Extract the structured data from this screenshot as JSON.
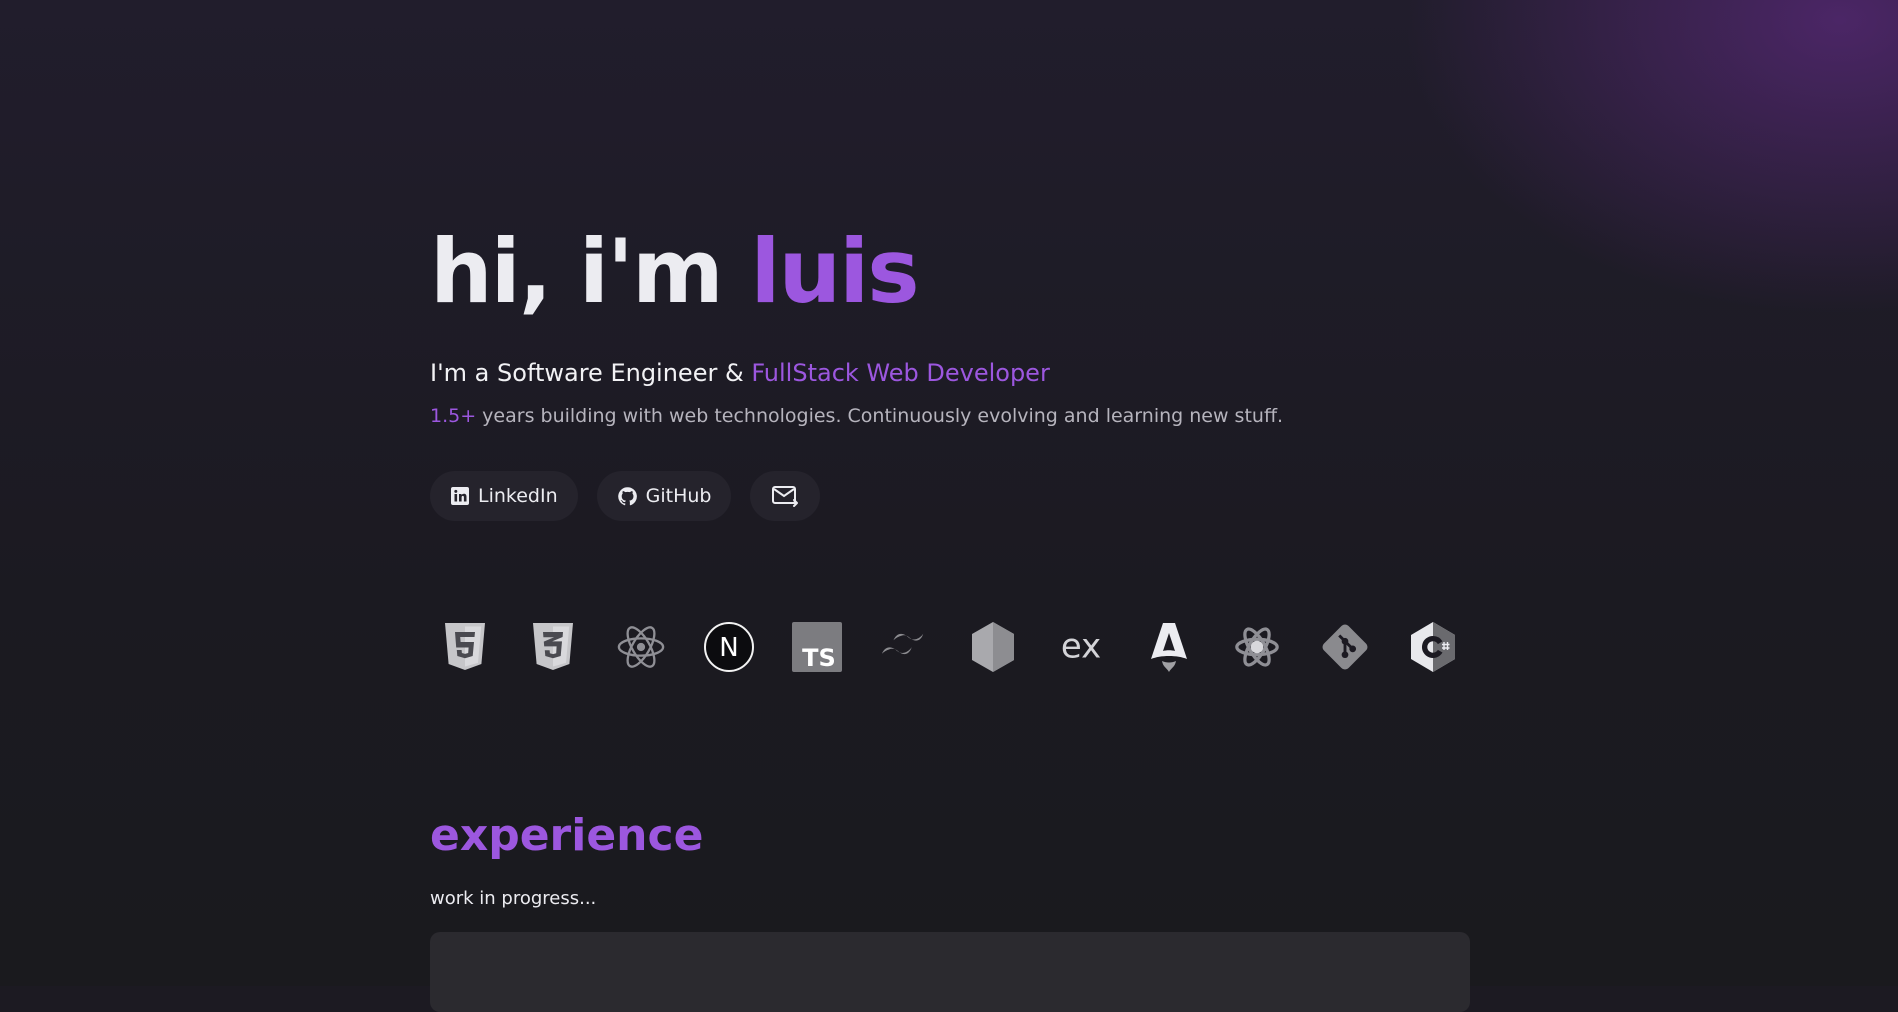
{
  "hero": {
    "greeting": "hi, i'm ",
    "name": "luis"
  },
  "subtitle": {
    "prefix": "I'm a Software Engineer & ",
    "highlight": "FullStack Web Developer"
  },
  "description": {
    "years": "1.5+",
    "text": " years building with web technologies. Continuously evolving and learning new stuff."
  },
  "socials": {
    "linkedin_label": "LinkedIn",
    "github_label": "GitHub",
    "mail_icon": "mail-icon"
  },
  "tech_icons": [
    "html5-icon",
    "css3-icon",
    "react-icon",
    "nextjs-icon",
    "typescript-icon",
    "tailwind-icon",
    "nodejs-icon",
    "express-icon",
    "astro-icon",
    "electron-icon",
    "git-icon",
    "csharp-icon"
  ],
  "tech_labels": {
    "typescript": "TS",
    "express": "ex",
    "nextjs": "N"
  },
  "experience": {
    "title": "experience",
    "note": "work in progress..."
  },
  "colors": {
    "accent": "#9c57df",
    "background": "#1c1a22",
    "pill": "#25232c",
    "card": "#2b2a2f"
  }
}
